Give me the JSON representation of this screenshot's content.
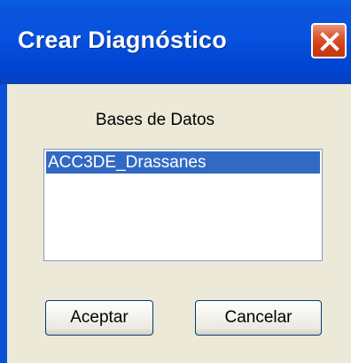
{
  "window": {
    "title": "Crear Diagnóstico"
  },
  "list": {
    "label": "Bases de Datos",
    "items": [
      {
        "label": "ACC3DE_Drassanes",
        "selected": true
      }
    ]
  },
  "buttons": {
    "ok_label": "Aceptar",
    "cancel_label": "Cancelar"
  },
  "icons": {
    "close": "close-icon"
  },
  "colors": {
    "titlebar": "#0147d4",
    "selection": "#316ac5",
    "dialog_background": "#ece9d8"
  }
}
